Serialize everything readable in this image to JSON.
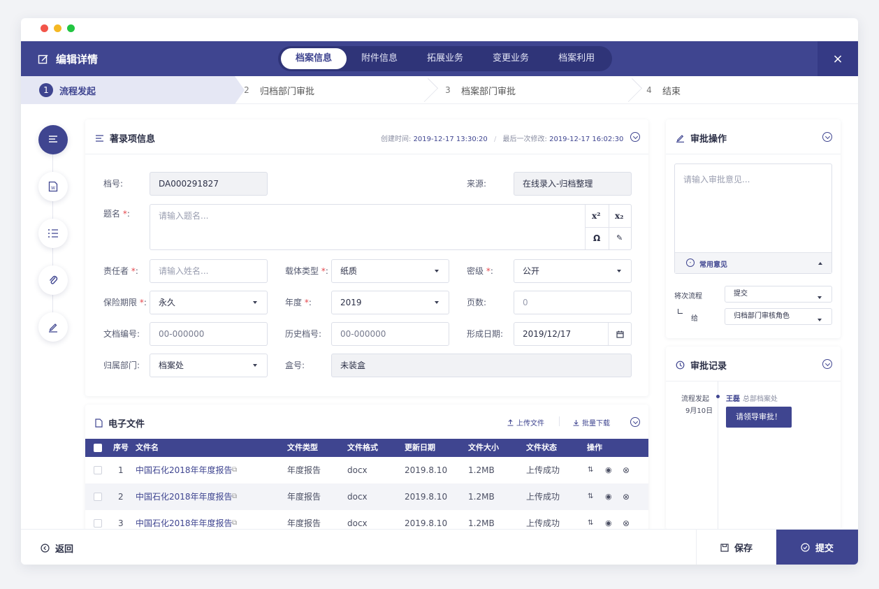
{
  "window": {
    "dots": [
      "#f2554a",
      "#f5b824",
      "#22c541"
    ]
  },
  "header": {
    "title": "编辑详情",
    "title_icon": "edit-icon",
    "tabs": [
      "档案信息",
      "附件信息",
      "拓展业务",
      "变更业务",
      "档案利用"
    ],
    "active_tab": "档案信息",
    "close": "×"
  },
  "steps": [
    {
      "num": "1",
      "label": "流程发起"
    },
    {
      "num": "2",
      "label": "归档部门审批"
    },
    {
      "num": "3",
      "label": "档案部门审批"
    },
    {
      "num": "4",
      "label": "结束"
    }
  ],
  "sidebar": {
    "icons": [
      "list-icon",
      "word-doc-icon",
      "ordered-list-icon",
      "attachment-icon",
      "pencil-icon"
    ]
  },
  "record": {
    "title": "著录项信息",
    "created_label": "创建时间:",
    "created": "2019-12-17 13:30:20",
    "sep": "/",
    "modified_label": "最后一次修改:",
    "modified": "2019-12-17 16:02:30",
    "fields": {
      "dangh": {
        "label": "档号:",
        "value": "DA000291827"
      },
      "laiyuan": {
        "label": "来源:",
        "value": "在线录入-归档整理"
      },
      "timing": {
        "label": "题名",
        "colon": ":",
        "placeholder": "请输入题名..."
      },
      "zerenzhe": {
        "label": "责任者",
        "colon": ":",
        "placeholder": "请输入姓名..."
      },
      "zaiti": {
        "label": "载体类型",
        "colon": ":",
        "value": "纸质"
      },
      "miji": {
        "label": "密级",
        "colon": ":",
        "value": "公开"
      },
      "baoxian": {
        "label": "保险期限",
        "colon": ":",
        "value": "永久"
      },
      "niandu": {
        "label": "年度",
        "colon": ":",
        "value": "2019"
      },
      "yeshu": {
        "label": "页数:",
        "value": "0"
      },
      "wendang": {
        "label": "文档编号:",
        "value": "00-000000"
      },
      "lishi": {
        "label": "历史档号:",
        "value": "00-000000"
      },
      "xingcheng": {
        "label": "形成日期:",
        "value": "2019/12/17"
      },
      "guishu": {
        "label": "归属部门:",
        "value": "档案处"
      },
      "hehao": {
        "label": "盒号:",
        "value": "未装盒"
      }
    },
    "required_mark": "*",
    "editor_buttons": [
      "x²",
      "x₂",
      "Ω",
      "✎"
    ]
  },
  "files": {
    "title": "电子文件",
    "upload": "上传文件",
    "download": "批量下载",
    "columns": [
      "序号",
      "文件名",
      "文件类型",
      "文件格式",
      "更新日期",
      "文件大小",
      "文件状态",
      "操作"
    ],
    "rows": [
      {
        "no": "1",
        "name": "中国石化2018年年度报告",
        "type": "年度报告",
        "format": "docx",
        "date": "2019.8.10",
        "size": "1.2MB",
        "status": "上传成功"
      },
      {
        "no": "2",
        "name": "中国石化2018年年度报告",
        "type": "年度报告",
        "format": "docx",
        "date": "2019.8.10",
        "size": "1.2MB",
        "status": "上传成功"
      },
      {
        "no": "3",
        "name": "中国石化2018年年度报告",
        "type": "年度报告",
        "format": "docx",
        "date": "2019.8.10",
        "size": "1.2MB",
        "status": "上传成功"
      }
    ]
  },
  "approval": {
    "title": "审批操作",
    "placeholder": "请输入审批意见...",
    "common": "常用意见",
    "next_label": "将次流程",
    "next_value": "提交",
    "to_label": "给",
    "to_value": "归档部门审核角色"
  },
  "records": {
    "title": "审批记录",
    "stage": "流程发起",
    "date": "9月10日",
    "user": "王磊",
    "dept": "总部档案处",
    "comment": "请领导审批！"
  },
  "footer": {
    "back": "返回",
    "save": "保存",
    "submit": "提交"
  }
}
